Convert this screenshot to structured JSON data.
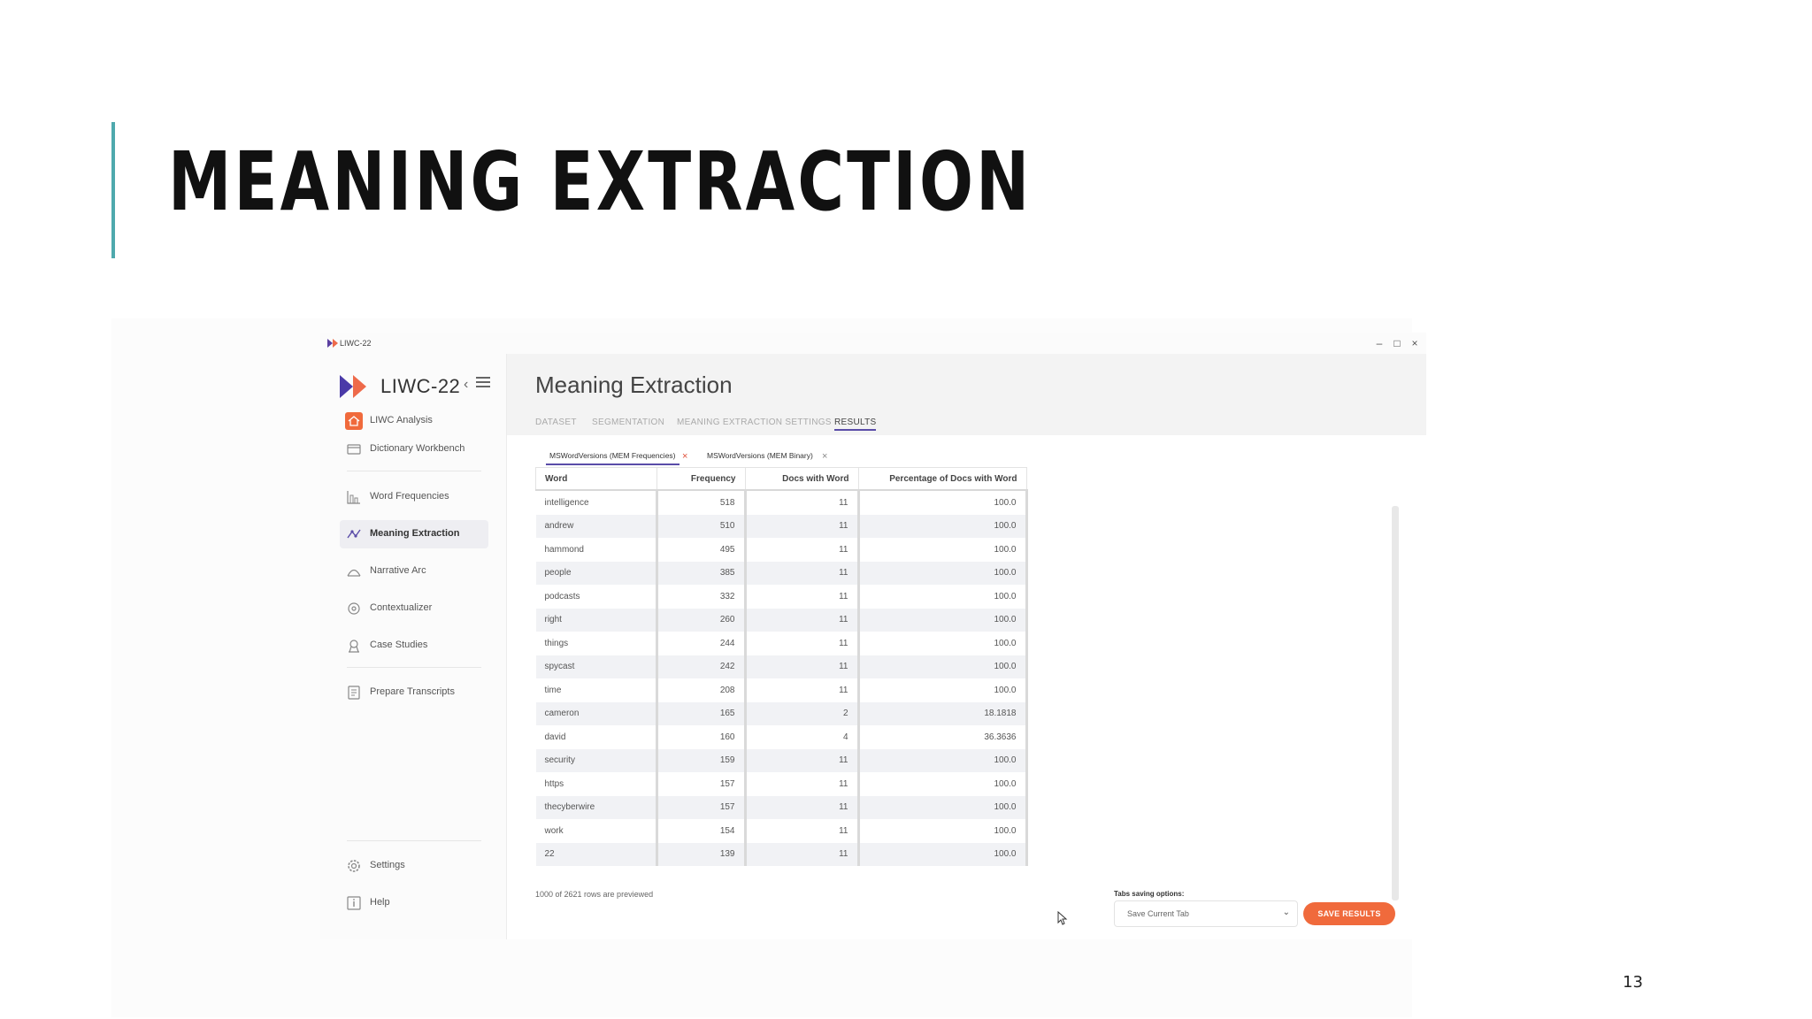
{
  "slide": {
    "title": "MEANING EXTRACTION",
    "page_number": "13"
  },
  "window": {
    "title": "LIWC-22",
    "minimize": "–",
    "maximize": "□",
    "close": "×"
  },
  "sidebar": {
    "app_name": "LIWC-22",
    "collapse": "‹",
    "items": [
      {
        "label": "LIWC Analysis",
        "icon": "home-icon"
      },
      {
        "label": "Dictionary Workbench",
        "icon": "dictionary-icon"
      },
      {
        "label": "Word Frequencies",
        "icon": "bar-chart-icon"
      },
      {
        "label": "Meaning Extraction",
        "icon": "meaning-extraction-icon",
        "active": true
      },
      {
        "label": "Narrative Arc",
        "icon": "narrative-arc-icon"
      },
      {
        "label": "Contextualizer",
        "icon": "contextualizer-icon"
      },
      {
        "label": "Case Studies",
        "icon": "case-studies-icon"
      },
      {
        "label": "Prepare Transcripts",
        "icon": "transcript-icon"
      }
    ],
    "footer_items": [
      {
        "label": "Settings",
        "icon": "gear-icon"
      },
      {
        "label": "Help",
        "icon": "help-icon"
      }
    ]
  },
  "main": {
    "title": "Meaning Extraction",
    "tabs": [
      {
        "label": "DATASET"
      },
      {
        "label": "SEGMENTATION"
      },
      {
        "label": "MEANING EXTRACTION SETTINGS"
      },
      {
        "label": "RESULTS",
        "active": true
      }
    ],
    "result_tabs": [
      {
        "label": "MSWordVersions (MEM Frequencies)",
        "active": true,
        "close": "×"
      },
      {
        "label": "MSWordVersions (MEM Binary)",
        "close": "×"
      }
    ],
    "table": {
      "headers": [
        "Word",
        "Frequency",
        "Docs with Word",
        "Percentage of Docs with Word"
      ],
      "rows": [
        [
          "intelligence",
          "518",
          "11",
          "100.0"
        ],
        [
          "andrew",
          "510",
          "11",
          "100.0"
        ],
        [
          "hammond",
          "495",
          "11",
          "100.0"
        ],
        [
          "people",
          "385",
          "11",
          "100.0"
        ],
        [
          "podcasts",
          "332",
          "11",
          "100.0"
        ],
        [
          "right",
          "260",
          "11",
          "100.0"
        ],
        [
          "things",
          "244",
          "11",
          "100.0"
        ],
        [
          "spycast",
          "242",
          "11",
          "100.0"
        ],
        [
          "time",
          "208",
          "11",
          "100.0"
        ],
        [
          "cameron",
          "165",
          "2",
          "18.1818"
        ],
        [
          "david",
          "160",
          "4",
          "36.3636"
        ],
        [
          "security",
          "159",
          "11",
          "100.0"
        ],
        [
          "https",
          "157",
          "11",
          "100.0"
        ],
        [
          "thecyberwire",
          "157",
          "11",
          "100.0"
        ],
        [
          "work",
          "154",
          "11",
          "100.0"
        ],
        [
          "22",
          "139",
          "11",
          "100.0"
        ]
      ]
    },
    "preview_note": "1000 of 2621 rows are previewed",
    "save_options_label": "Tabs saving options:",
    "save_option_selected": "Save Current Tab",
    "save_button": "SAVE RESULTS"
  },
  "colors": {
    "accent_teal": "#4ea9ad",
    "active_tab": "#5a4ca8",
    "save_button": "#f06a3c",
    "close_red": "#e0503a"
  }
}
